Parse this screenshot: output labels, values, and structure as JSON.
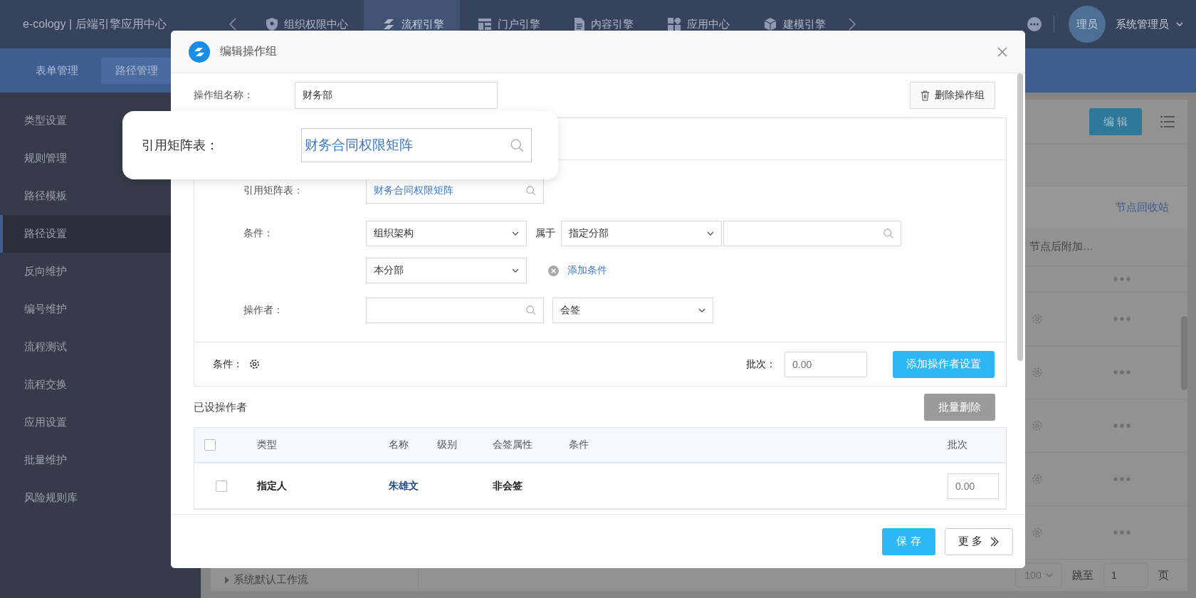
{
  "top_nav": {
    "brand": "e-cology | 后端引擎应用中心",
    "tabs": [
      {
        "label": "组织权限中心",
        "selected": false,
        "kind": "shield"
      },
      {
        "label": "流程引擎",
        "selected": true,
        "kind": "flow"
      },
      {
        "label": "门户引擎",
        "selected": false,
        "kind": "portal"
      },
      {
        "label": "内容引擎",
        "selected": false,
        "kind": "doc"
      },
      {
        "label": "应用中心",
        "selected": false,
        "kind": "apps"
      },
      {
        "label": "建模引擎",
        "selected": false,
        "kind": "cube"
      }
    ],
    "user": {
      "avatar": "理员",
      "name": "系统管理员"
    }
  },
  "sub_nav": {
    "tabs": [
      {
        "label": "表单管理",
        "selected": false
      },
      {
        "label": "路径管理",
        "selected": true
      }
    ]
  },
  "sidebar": {
    "items": [
      {
        "label": "类型设置",
        "selected": false
      },
      {
        "label": "规则管理",
        "selected": false
      },
      {
        "label": "路径模板",
        "selected": false
      },
      {
        "label": "路径设置",
        "selected": true
      },
      {
        "label": "反向维护",
        "selected": false
      },
      {
        "label": "编号维护",
        "selected": false
      },
      {
        "label": "流程测试",
        "selected": false
      },
      {
        "label": "流程交换",
        "selected": false
      },
      {
        "label": "应用设置",
        "selected": false
      },
      {
        "label": "批量维护",
        "selected": false
      },
      {
        "label": "风险规则库",
        "selected": false
      }
    ]
  },
  "content": {
    "edit_button": "编 辑",
    "recycle_link": "节点回收站",
    "row_text": "节点后附加…",
    "tree_item": "系统默认工作流",
    "page_size": "100",
    "jump_label": "跳至",
    "page_input": "1",
    "page_unit": "页"
  },
  "dialog": {
    "title": "编辑操作组",
    "name_label": "操作组名称：",
    "name_value": "财务部",
    "delete_button": "删除操作组",
    "matrix": {
      "label": "引用矩阵表：",
      "value": "财务合同权限矩阵"
    },
    "condition": {
      "label": "条件：",
      "field": "组织架构",
      "relation": "属于",
      "scope": "指定分部",
      "sub_scope": "本分部",
      "add_link": "添加条件"
    },
    "operator": {
      "label": "操作者：",
      "sign_mode": "会签"
    },
    "footer": {
      "condition_label": "条件：",
      "batch_label": "批次：",
      "batch_value": "0.00",
      "add_button": "添加操作者设置"
    },
    "assigned": {
      "title": "已设操作者",
      "bulk_delete": {
        "label": "批量删除",
        "disabled": true
      },
      "header_checked": false,
      "columns": [
        "类型",
        "名称",
        "级别",
        "会签属性",
        "条件",
        "批次"
      ],
      "rows": [
        {
          "checked": false,
          "type": "指定人",
          "name": "朱雄文",
          "sign": "非会签",
          "batch": "0.00"
        }
      ]
    },
    "save_button": "保 存",
    "more_button": "更 多"
  },
  "callout": {
    "label": "引用矩阵表：",
    "value": "财务合同权限矩阵"
  }
}
